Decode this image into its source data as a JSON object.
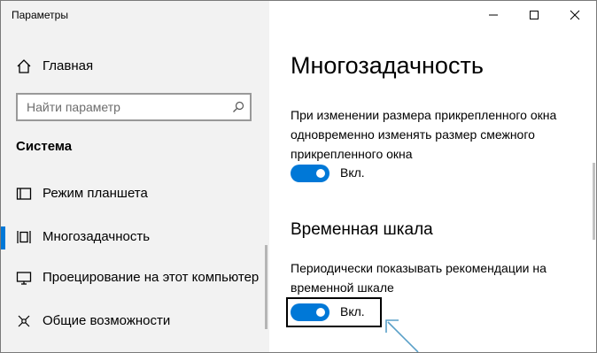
{
  "window": {
    "title": "Параметры",
    "controls": [
      "minimize",
      "maximize",
      "close"
    ]
  },
  "sidebar": {
    "home_label": "Главная",
    "home_icon": "home-icon",
    "search_placeholder": "Найти параметр",
    "search_icon": "search-icon",
    "section_title": "Система",
    "items": [
      {
        "label": "Режим планшета",
        "icon": "tablet-mode-icon",
        "selected": false
      },
      {
        "label": "Многозадачность",
        "icon": "multitasking-icon",
        "selected": true
      },
      {
        "label": "Проецирование на этот компьютер",
        "icon": "projecting-icon",
        "selected": false
      },
      {
        "label": "Общие возможности",
        "icon": "shared-experiences-icon",
        "selected": false
      }
    ]
  },
  "main": {
    "title": "Многозадачность",
    "snap_description": "При изменении размера прикрепленного окна одновременно изменять размер смежного прикрепленного окна",
    "snap_toggle_label": "Вкл.",
    "snap_toggle_on": true,
    "timeline_title": "Временная шкала",
    "timeline_description": "Периодически показывать рекомендации на временной шкале",
    "timeline_toggle_label": "Вкл.",
    "timeline_toggle_on": true
  },
  "colors": {
    "accent": "#0078d7",
    "sidebar_bg": "#f2f2f2",
    "annotation_arrow": "#5aa0c8"
  }
}
